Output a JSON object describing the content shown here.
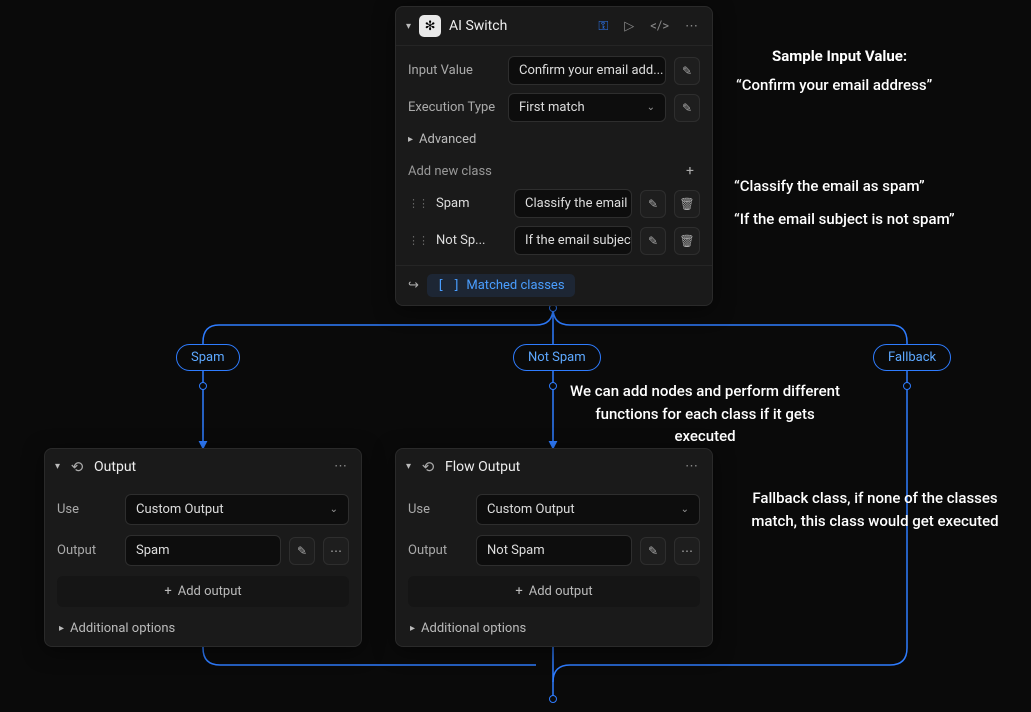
{
  "aiSwitch": {
    "title": "AI Switch",
    "fields": {
      "inputValueLabel": "Input Value",
      "inputValuePlaceholder": "Confirm your email add...",
      "executionTypeLabel": "Execution Type",
      "executionTypeValue": "First match",
      "advancedLabel": "Advanced",
      "addNewClassLabel": "Add new class"
    },
    "classes": [
      {
        "name": "Spam",
        "prompt": "Classify the email ..."
      },
      {
        "name": "Not Sp...",
        "prompt": "If the email subject..."
      }
    ],
    "footer": {
      "matchedLabel": "Matched classes"
    }
  },
  "branches": {
    "spam": "Spam",
    "notSpam": "Not Spam",
    "fallback": "Fallback"
  },
  "outputNode1": {
    "title": "Output",
    "useLabel": "Use",
    "useValue": "Custom Output",
    "outputLabel": "Output",
    "outputValue": "Spam",
    "addOutput": "Add output",
    "additionalOptions": "Additional options"
  },
  "outputNode2": {
    "title": "Flow Output",
    "useLabel": "Use",
    "useValue": "Custom Output",
    "outputLabel": "Output",
    "outputValue": "Not Spam",
    "addOutput": "Add output",
    "additionalOptions": "Additional options"
  },
  "annotations": {
    "sampleHeader": "Sample Input Value:",
    "sampleValue": "“Confirm your email address”",
    "classifyHint": "“Classify the email as spam”",
    "notSpamHint": "“If the email subject is not spam”",
    "branchHint": "We can add nodes and perform different functions for each class if it gets executed",
    "fallbackHint": "Fallback class, if none of the classes match, this class would get executed"
  }
}
